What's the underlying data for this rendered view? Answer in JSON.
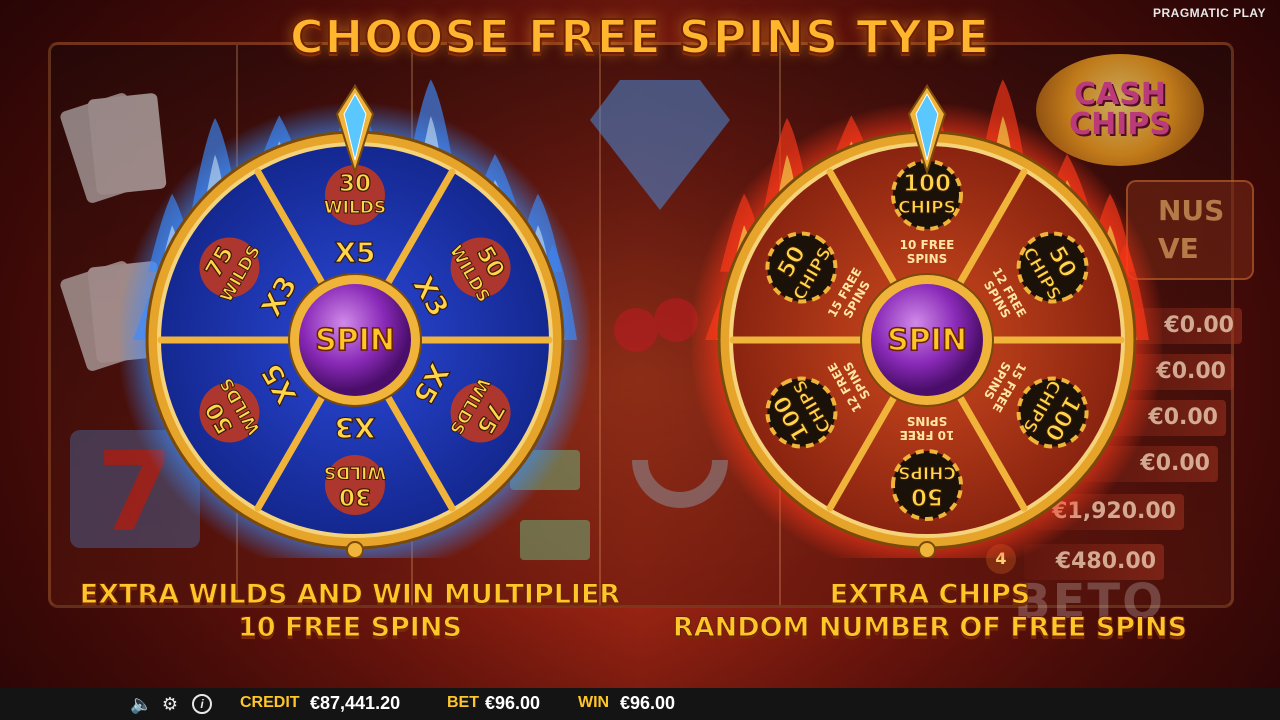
{
  "brand": "PRAGMATIC PLAY",
  "title": "CHOOSE FREE SPINS TYPE",
  "logo_text": "CASH CHIPS",
  "background_panel": {
    "line1": "NUS",
    "line2": "VE"
  },
  "background_paytable": [
    "€0.00",
    "€0.00",
    "€0.00",
    "€0.00",
    "€1,920.00",
    "€480.00"
  ],
  "background_level": "4",
  "watermark": "BETO",
  "blue_wheel": {
    "center_label": "SPIN",
    "outer": [
      {
        "amount": "30",
        "word": "WILDS"
      },
      {
        "amount": "50",
        "word": "WILDS"
      },
      {
        "amount": "75",
        "word": "WILDS"
      },
      {
        "amount": "30",
        "word": "WILDS"
      },
      {
        "amount": "50",
        "word": "WILDS"
      },
      {
        "amount": "75",
        "word": "WILDS"
      }
    ],
    "inner": [
      "X5",
      "X3",
      "X5",
      "X3",
      "X5",
      "X3"
    ],
    "caption_line1": "EXTRA WILDS AND WIN MULTIPLIER",
    "caption_line2": "10 FREE SPINS",
    "colors": {
      "face": "#1e35b4",
      "rim": "#e6a52a",
      "flame": "#3c8cff"
    }
  },
  "red_wheel": {
    "center_label": "SPIN",
    "outer": [
      {
        "amount": "100",
        "word": "CHIPS"
      },
      {
        "amount": "50",
        "word": "CHIPS"
      },
      {
        "amount": "100",
        "word": "CHIPS"
      },
      {
        "amount": "50",
        "word": "CHIPS"
      },
      {
        "amount": "100",
        "word": "CHIPS"
      },
      {
        "amount": "50",
        "word": "CHIPS"
      }
    ],
    "inner": [
      "10 FREE\nSPINS",
      "12 FREE\nSPINS",
      "15 FREE\nSPINS",
      "10 FREE\nSPINS",
      "12 FREE\nSPINS",
      "15 FREE\nSPINS"
    ],
    "caption_line1": "EXTRA CHIPS",
    "caption_line2": "RANDOM NUMBER OF FREE SPINS",
    "colors": {
      "face": "#b83a18",
      "rim": "#e6a52a",
      "flame": "#ff3a1a"
    }
  },
  "bottom_bar": {
    "credit_label": "CREDIT",
    "credit_value": "€87,441.20",
    "bet_label": "BET",
    "bet_value": "€96.00",
    "win_label": "WIN",
    "win_value": "€96.00",
    "icons": [
      "speaker-icon",
      "gear-icon",
      "info-icon"
    ]
  }
}
